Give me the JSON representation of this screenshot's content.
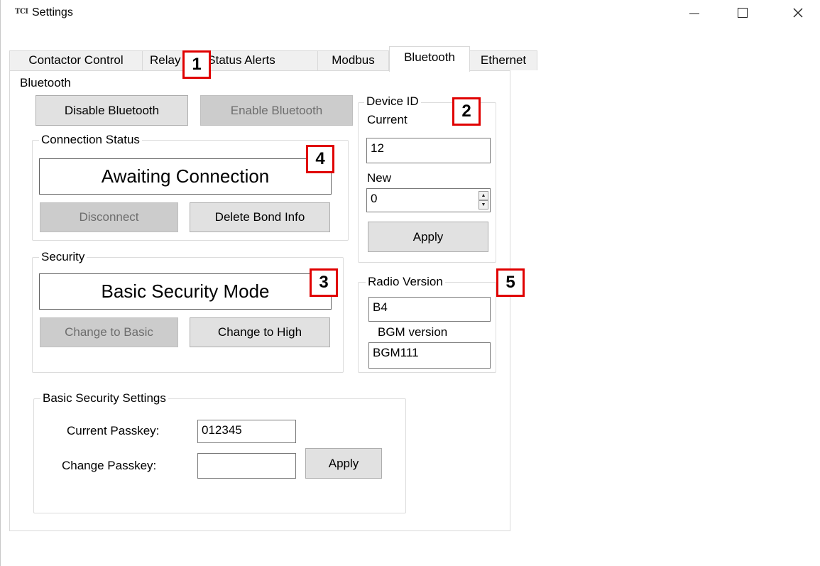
{
  "window": {
    "app_logo": "TCI",
    "title": "Settings"
  },
  "tabs": [
    {
      "label": "Contactor Control"
    },
    {
      "label": "Relay and Status Alerts"
    },
    {
      "label": "Modbus"
    },
    {
      "label": "Bluetooth",
      "active": true
    },
    {
      "label": "Ethernet"
    }
  ],
  "bluetooth": {
    "legend": "Bluetooth",
    "disable_button": "Disable Bluetooth",
    "enable_button": "Enable Bluetooth"
  },
  "connection": {
    "legend": "Connection Status",
    "status": "Awaiting Connection",
    "disconnect_button": "Disconnect",
    "delete_bond_button": "Delete Bond Info"
  },
  "security": {
    "legend": "Security",
    "status": "Basic Security Mode",
    "change_basic_button": "Change to Basic",
    "change_high_button": "Change to High"
  },
  "device_id": {
    "legend": "Device ID",
    "current_label": "Current",
    "current_value": "12",
    "new_label": "New",
    "new_value": "0",
    "apply_button": "Apply"
  },
  "radio": {
    "legend": "Radio Version",
    "radio_value": "B4",
    "bgm_label": "BGM version",
    "bgm_value": "BGM111"
  },
  "basic_security": {
    "legend": "Basic Security Settings",
    "current_passkey_label": "Current Passkey:",
    "current_passkey_value": "012345",
    "change_passkey_label": "Change Passkey:",
    "change_passkey_value": "",
    "apply_button": "Apply"
  },
  "callouts": [
    "1",
    "2",
    "3",
    "4",
    "5"
  ]
}
